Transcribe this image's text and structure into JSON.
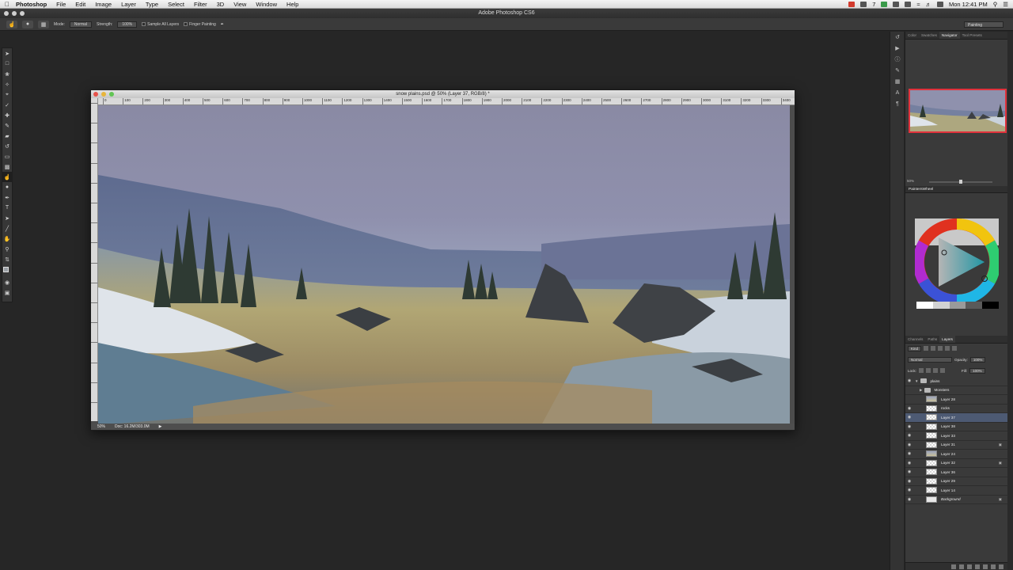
{
  "menubar": {
    "apple": "",
    "app_name": "Photoshop",
    "items": [
      "File",
      "Edit",
      "Image",
      "Layer",
      "Type",
      "Select",
      "Filter",
      "3D",
      "View",
      "Window",
      "Help"
    ],
    "clock": "Mon 12:41 PM",
    "tray_text": "7"
  },
  "app_title": "Adobe Photoshop CS6",
  "options_bar": {
    "mode_label": "Mode:",
    "mode_value": "Normal",
    "strength_label": "Strength:",
    "strength_value": "100%",
    "sample_all_layers": "Sample All Layers",
    "finger_painting": "Finger Painting",
    "workspace": "Painting"
  },
  "document": {
    "title": "snow plains.psd @ 50% (Layer 37, RGB/8) *",
    "zoom": "50%",
    "doc_size": "Doc: 16.2M/303.0M",
    "ruler_labels": [
      "0",
      "100",
      "200",
      "300",
      "400",
      "500",
      "600",
      "700",
      "800",
      "900",
      "1000",
      "1100",
      "1200",
      "1300",
      "1400",
      "1500",
      "1600",
      "1700",
      "1800",
      "1900",
      "2000",
      "2100",
      "2200",
      "2300",
      "2400",
      "2500",
      "2600",
      "2700",
      "2800",
      "2900",
      "3000",
      "3100",
      "3200",
      "3300",
      "3400"
    ]
  },
  "top_panel": {
    "tabs": [
      "Color",
      "Swatches",
      "Navigator",
      "Tool Presets"
    ],
    "active_tab": "Navigator",
    "zoom": "50%"
  },
  "painters_wheel": {
    "title": "PaintersWheel"
  },
  "layers_panel": {
    "tabs": [
      "Channels",
      "Paths",
      "Layers"
    ],
    "active_tab": "Layers",
    "kind_filter": "Kind",
    "blend_mode": "Normal",
    "opacity_label": "Opacity:",
    "opacity_value": "100%",
    "lock_label": "Lock:",
    "fill_label": "Fill:",
    "fill_value": "100%",
    "layers": [
      {
        "name": "plains",
        "type": "group-open",
        "thumb": "folder",
        "visible": true,
        "locked": false,
        "selected": false,
        "italic": false
      },
      {
        "name": "Monsters",
        "type": "group-closed",
        "thumb": "folder",
        "visible": false,
        "locked": false,
        "selected": false,
        "italic": false
      },
      {
        "name": "Layer 28",
        "type": "layer",
        "thumb": "scene",
        "visible": false,
        "locked": false,
        "selected": false,
        "italic": false
      },
      {
        "name": "rocks",
        "type": "layer",
        "thumb": "transparent",
        "visible": true,
        "locked": false,
        "selected": false,
        "italic": false
      },
      {
        "name": "Layer 37",
        "type": "layer",
        "thumb": "transparent",
        "visible": true,
        "locked": false,
        "selected": true,
        "italic": false
      },
      {
        "name": "Layer 38",
        "type": "layer",
        "thumb": "transparent",
        "visible": true,
        "locked": false,
        "selected": false,
        "italic": false
      },
      {
        "name": "Layer 33",
        "type": "layer",
        "thumb": "transparent",
        "visible": true,
        "locked": false,
        "selected": false,
        "italic": false
      },
      {
        "name": "Layer 31",
        "type": "layer",
        "thumb": "transparent",
        "visible": true,
        "locked": true,
        "selected": false,
        "italic": false
      },
      {
        "name": "Layer 24",
        "type": "layer",
        "thumb": "scene",
        "visible": true,
        "locked": false,
        "selected": false,
        "italic": false
      },
      {
        "name": "Layer 32",
        "type": "layer",
        "thumb": "transparent",
        "visible": true,
        "locked": true,
        "selected": false,
        "italic": false
      },
      {
        "name": "Layer 36",
        "type": "layer",
        "thumb": "transparent",
        "visible": true,
        "locked": false,
        "selected": false,
        "italic": false
      },
      {
        "name": "Layer 29",
        "type": "layer",
        "thumb": "transparent",
        "visible": true,
        "locked": false,
        "selected": false,
        "italic": false
      },
      {
        "name": "Layer 14",
        "type": "layer",
        "thumb": "transparent",
        "visible": true,
        "locked": false,
        "selected": false,
        "italic": false
      },
      {
        "name": "Background",
        "type": "layer",
        "thumb": "white",
        "visible": true,
        "locked": true,
        "selected": false,
        "italic": true
      }
    ]
  },
  "colors": {
    "accent": "#4d5a73",
    "nav_frame": "#e0323c"
  }
}
